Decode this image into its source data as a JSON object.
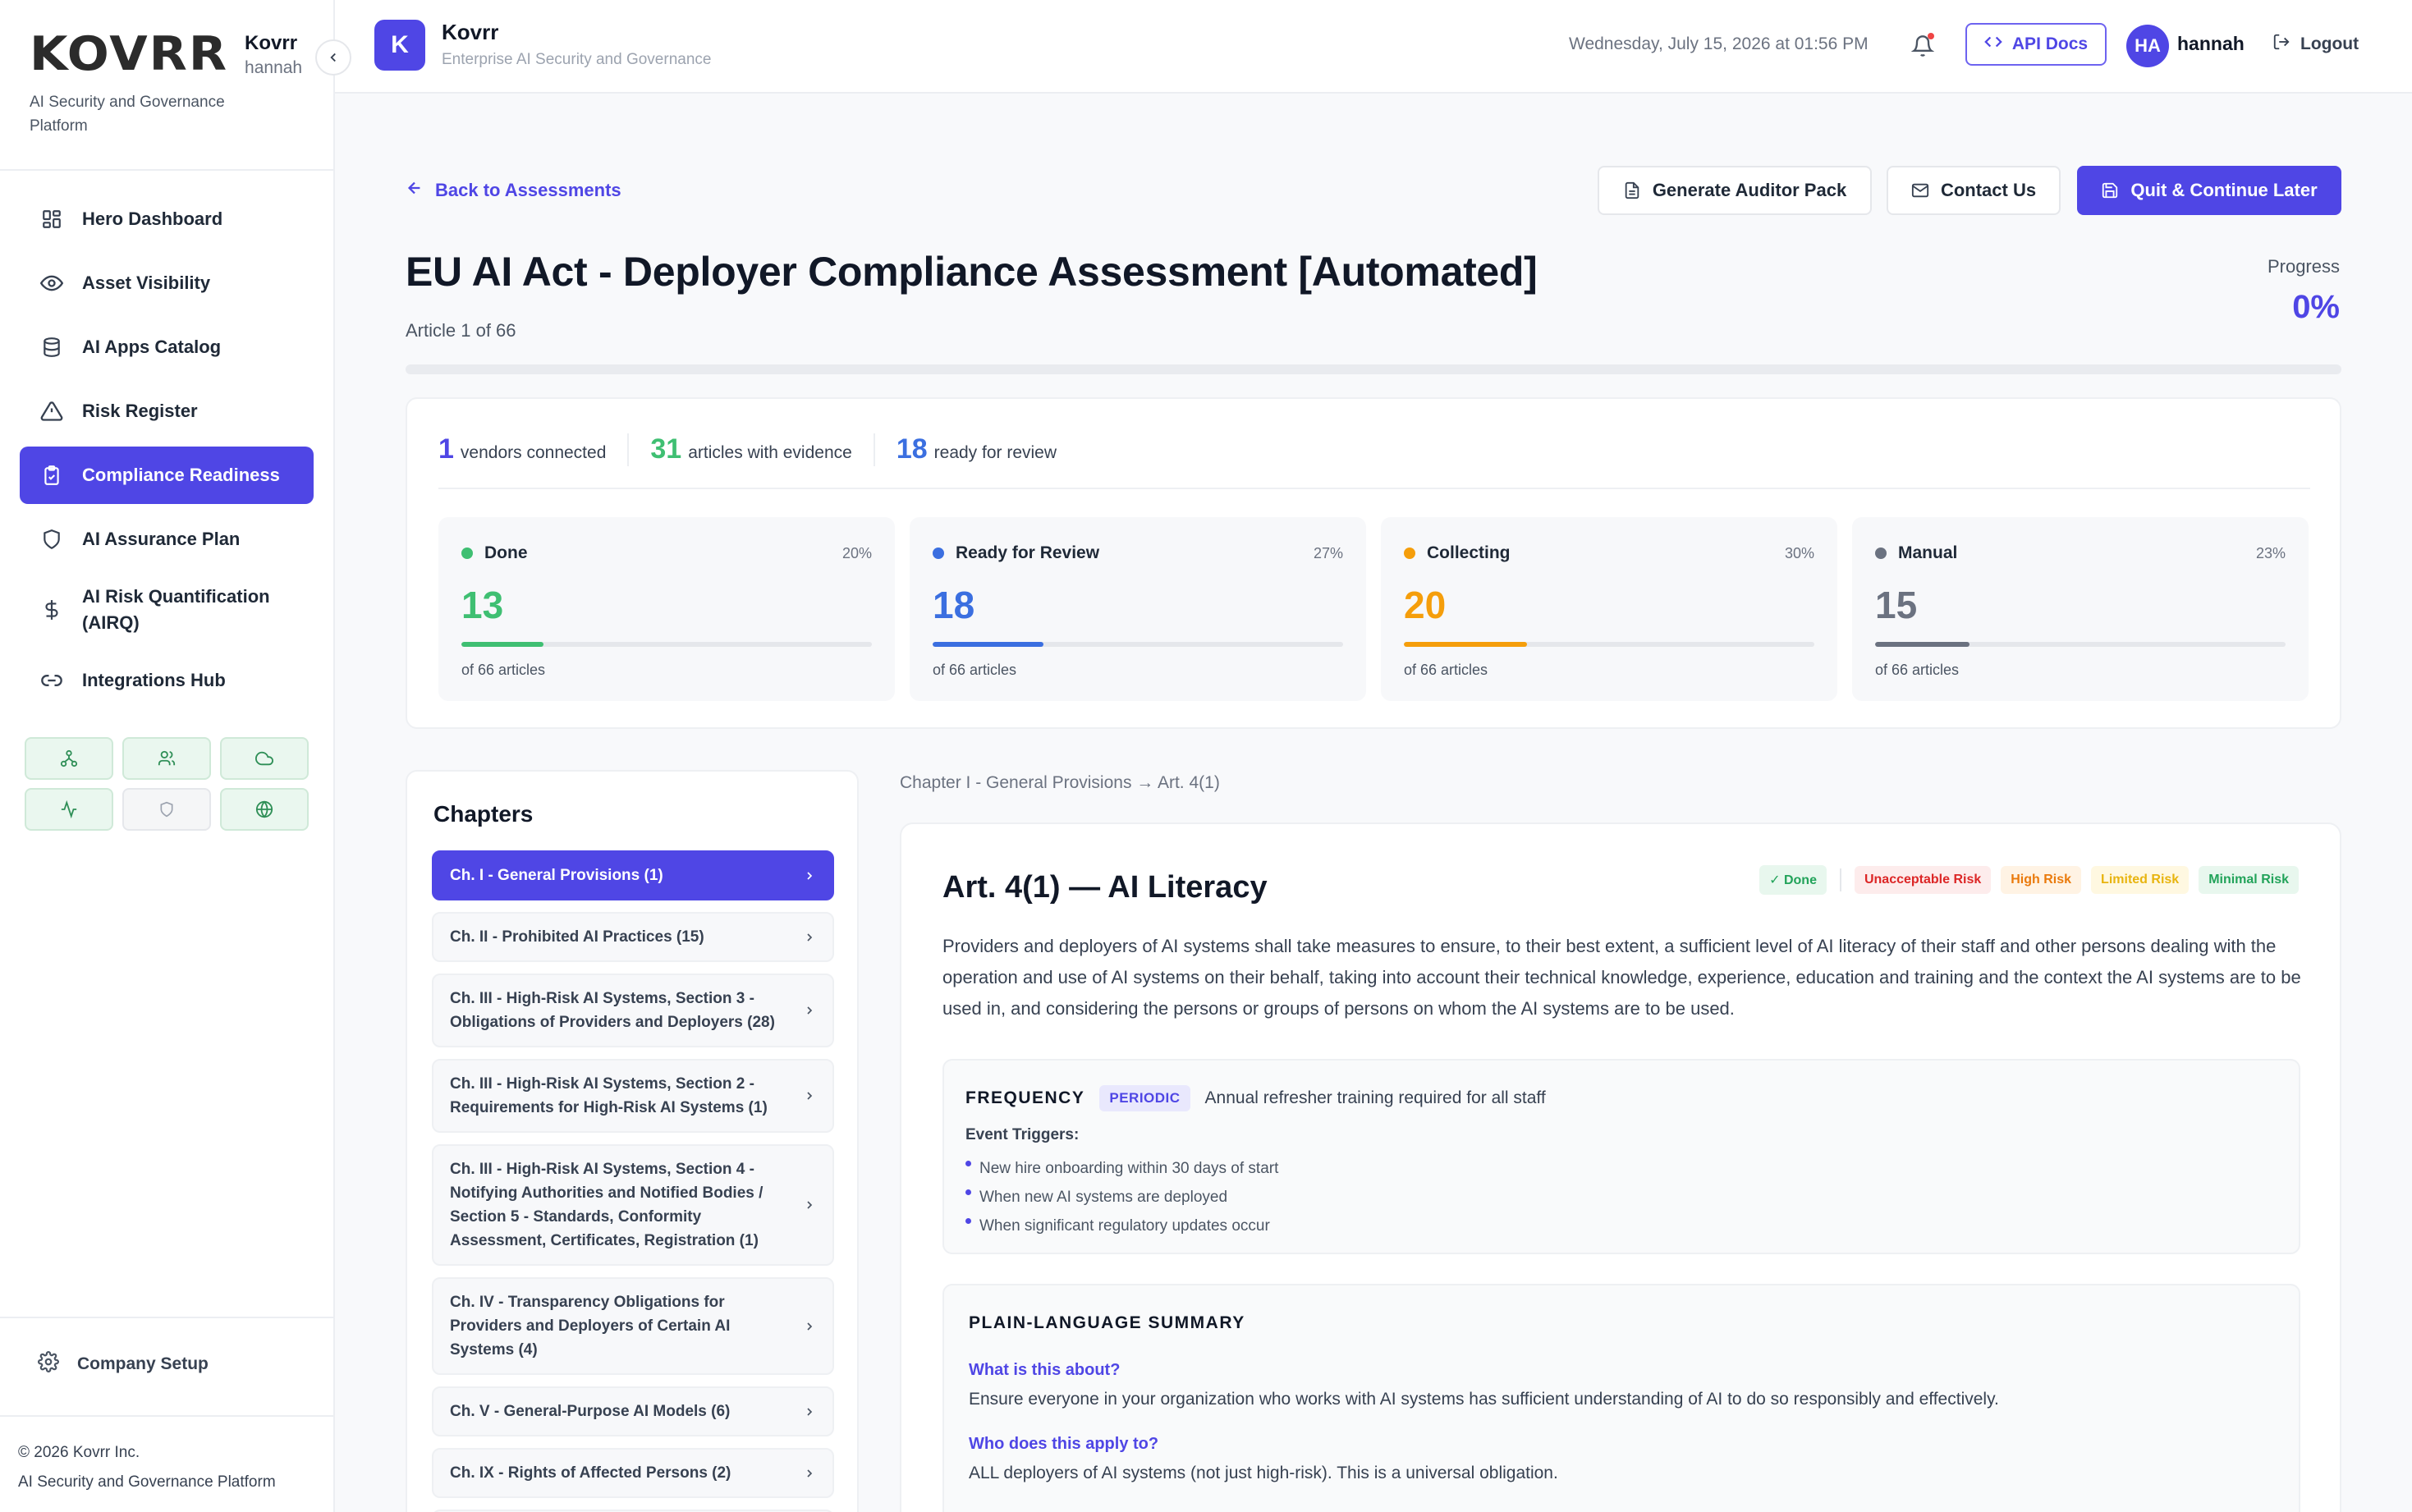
{
  "sidebar": {
    "logo": "KOVRR",
    "org_name": "Kovrr",
    "user": "hannah",
    "subtitle": "AI Security and Governance Platform",
    "nav": [
      {
        "label": "Hero Dashboard",
        "icon": "grid-icon",
        "active": false
      },
      {
        "label": "Asset Visibility",
        "icon": "eye-icon",
        "active": false
      },
      {
        "label": "AI Apps Catalog",
        "icon": "database-icon",
        "active": false
      },
      {
        "label": "Risk Register",
        "icon": "warning-icon",
        "active": false
      },
      {
        "label": "Compliance Readiness",
        "icon": "clipboard-check-icon",
        "active": true
      },
      {
        "label": "AI Assurance Plan",
        "icon": "shield-icon",
        "active": false
      },
      {
        "label": "AI Risk Quantification (AIRQ)",
        "icon": "dollar-icon",
        "active": false
      },
      {
        "label": "Integrations Hub",
        "icon": "link-icon",
        "active": false
      }
    ],
    "quick_icons": [
      "network-icon",
      "users-icon",
      "cloud-icon",
      "activity-icon",
      "shield-outline-icon",
      "globe-icon"
    ],
    "company_setup": "Company Setup",
    "copyright": "© 2026 Kovrr Inc.",
    "footer_sub": "AI Security and Governance Platform"
  },
  "topbar": {
    "badge": "K",
    "app_name": "Kovrr",
    "app_sub": "Enterprise AI Security and Governance",
    "datetime": "Wednesday, July 15, 2026 at 01:56 PM",
    "api_docs": "API Docs",
    "avatar": "HA",
    "username": "hannah",
    "logout": "Logout"
  },
  "header": {
    "back": "Back to Assessments",
    "btn_auditor": "Generate Auditor Pack",
    "btn_contact": "Contact Us",
    "btn_quit": "Quit & Continue Later",
    "title": "EU AI Act - Deployer Compliance Assessment [Automated]",
    "article_count": "Article 1 of 66",
    "progress_label": "Progress",
    "progress_value": "0%",
    "progress_fraction": 0
  },
  "stats": {
    "vendors_num": "1",
    "vendors_lbl": "vendors connected",
    "evidence_num": "31",
    "evidence_lbl": "articles with evidence",
    "review_num": "18",
    "review_lbl": "ready for review",
    "boxes": [
      {
        "label": "Done",
        "pct": "20%",
        "value": "13",
        "of": "of 66 articles",
        "color": "#3fbf72",
        "fraction": 0.2
      },
      {
        "label": "Ready for Review",
        "pct": "27%",
        "value": "18",
        "of": "of 66 articles",
        "color": "#3b6fe0",
        "fraction": 0.27
      },
      {
        "label": "Collecting",
        "pct": "30%",
        "value": "20",
        "of": "of 66 articles",
        "color": "#f59e0b",
        "fraction": 0.3
      },
      {
        "label": "Manual",
        "pct": "23%",
        "value": "15",
        "of": "of 66 articles",
        "color": "#6b7280",
        "fraction": 0.23
      }
    ]
  },
  "chapters": {
    "title": "Chapters",
    "items": [
      {
        "label": "Ch. I - General Provisions (1)",
        "active": true
      },
      {
        "label": "Ch. II - Prohibited AI Practices (15)",
        "active": false
      },
      {
        "label": "Ch. III - High-Risk AI Systems, Section 3 - Obligations of Providers and Deployers (28)",
        "active": false
      },
      {
        "label": "Ch. III - High-Risk AI Systems, Section 2 - Requirements for High-Risk AI Systems (1)",
        "active": false
      },
      {
        "label": "Ch. III - High-Risk AI Systems, Section 4 - Notifying Authorities and Notified Bodies / Section 5 - Standards, Conformity Assessment, Certificates, Registration (1)",
        "active": false
      },
      {
        "label": "Ch. IV - Transparency Obligations for Providers and Deployers of Certain AI Systems (4)",
        "active": false
      },
      {
        "label": "Ch. V - General-Purpose AI Models (6)",
        "active": false
      },
      {
        "label": "Ch. IX - Rights of Affected Persons (2)",
        "active": false
      },
      {
        "label": "",
        "active": false
      }
    ]
  },
  "breadcrumb": "Chapter I - General Provisions → Art. 4(1)",
  "article": {
    "title": "Art. 4(1) — AI Literacy",
    "status_badge": "✓ Done",
    "risk_badges": [
      {
        "label": "Unacceptable Risk",
        "fg": "#dc2626",
        "bg": "#fdecec"
      },
      {
        "label": "High Risk",
        "fg": "#ea7a0c",
        "bg": "#fff3e4"
      },
      {
        "label": "Limited Risk",
        "fg": "#e8b40f",
        "bg": "#fff8e1"
      },
      {
        "label": "Minimal Risk",
        "fg": "#22a35a",
        "bg": "#e8f7ee"
      }
    ],
    "body": "Providers and deployers of AI systems shall take measures to ensure, to their best extent, a sufficient level of AI literacy of their staff and other persons dealing with the operation and use of AI systems on their behalf, taking into account their technical knowledge, experience, education and training and the context the AI systems are to be used in, and considering the persons or groups of persons on whom the AI systems are to be used.",
    "frequency_label": "FREQUENCY",
    "frequency_tag": "PERIODIC",
    "frequency_desc": "Annual refresher training required for all staff",
    "triggers_label": "Event Triggers:",
    "triggers": [
      "New hire onboarding within 30 days of start",
      "When new AI systems are deployed",
      "When significant regulatory updates occur"
    ],
    "summary_label": "PLAIN-LANGUAGE SUMMARY",
    "qa": [
      {
        "q": "What is this about?",
        "a": "Ensure everyone in your organization who works with AI systems has sufficient understanding of AI to do so responsibly and effectively."
      },
      {
        "q": "Who does this apply to?",
        "a": "ALL deployers of AI systems (not just high-risk). This is a universal obligation."
      }
    ]
  }
}
